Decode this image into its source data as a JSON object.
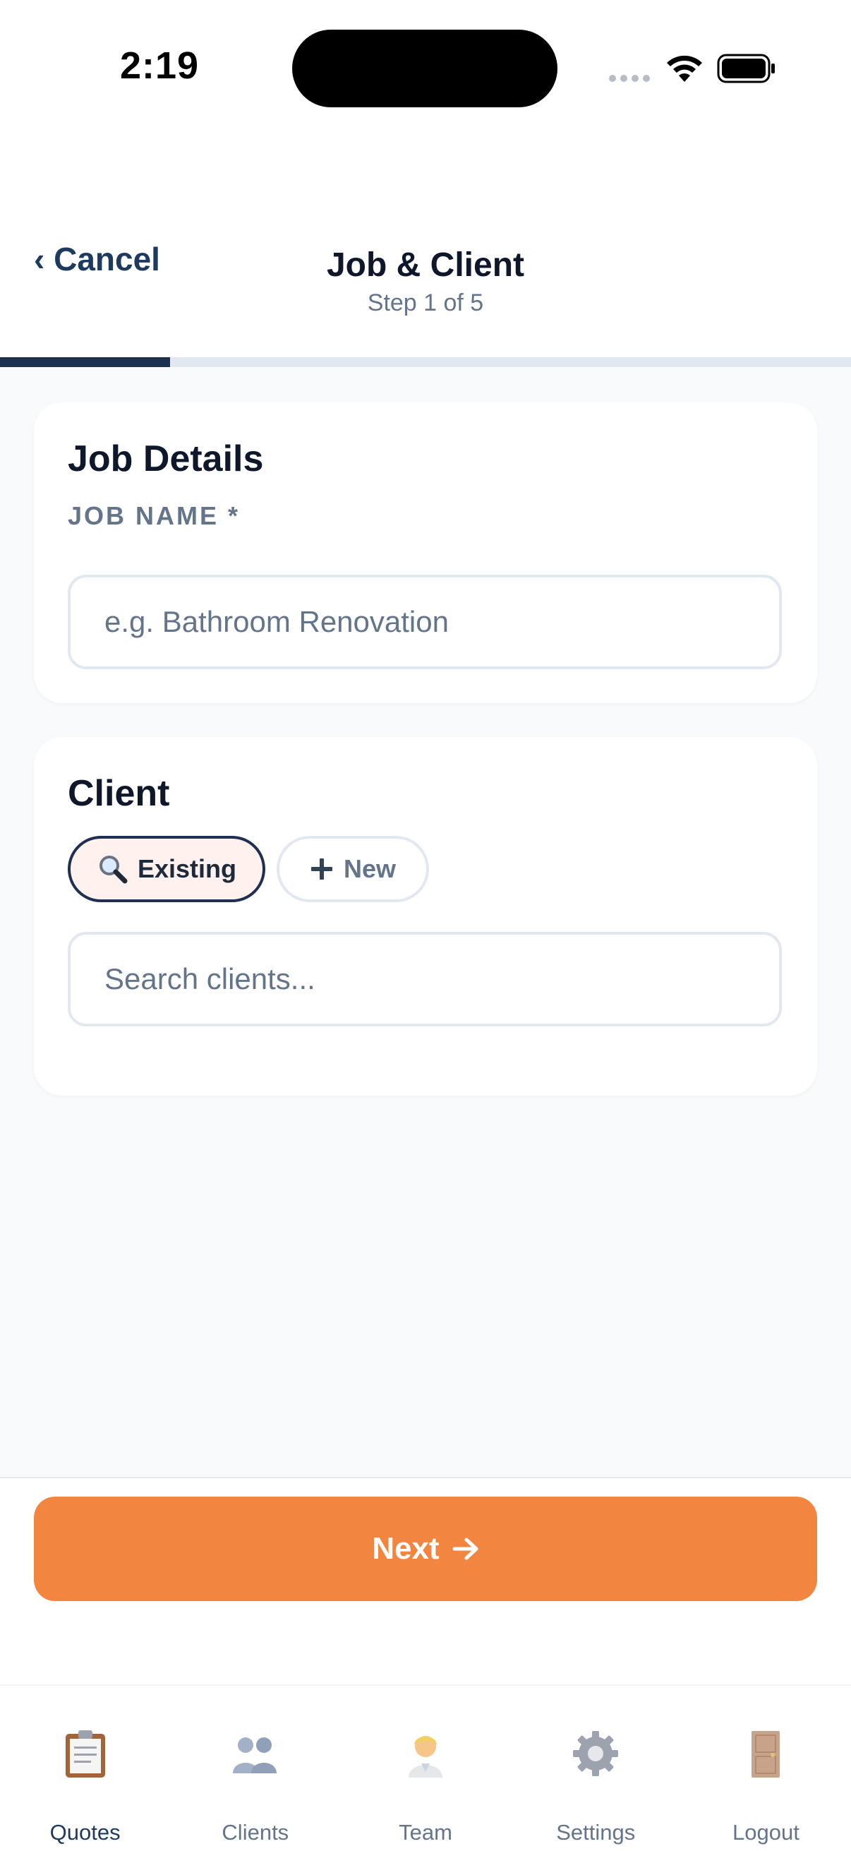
{
  "status_bar": {
    "time": "2:19"
  },
  "header": {
    "cancel_label": "‹ Cancel",
    "title": "Job & Client",
    "subtitle": "Step 1 of 5",
    "progress": 0.2
  },
  "job_details": {
    "title": "Job Details",
    "job_name_label": "JOB NAME *",
    "job_name_placeholder": "e.g. Bathroom Renovation",
    "job_name_value": ""
  },
  "client": {
    "title": "Client",
    "existing_label": "Existing",
    "new_label": "New",
    "search_placeholder": "Search clients...",
    "search_value": "",
    "selected_mode": "existing"
  },
  "footer": {
    "next_label": "Next"
  },
  "tabs": [
    {
      "label": "Quotes",
      "icon": "clipboard-icon",
      "active": true
    },
    {
      "label": "Clients",
      "icon": "people-icon",
      "active": false
    },
    {
      "label": "Team",
      "icon": "person-icon",
      "active": false
    },
    {
      "label": "Settings",
      "icon": "gear-icon",
      "active": false
    },
    {
      "label": "Logout",
      "icon": "door-icon",
      "active": false
    }
  ],
  "colors": {
    "accent": "#f28640",
    "primary": "#1e2f4f",
    "chip_active_bg": "#fff1ee"
  }
}
